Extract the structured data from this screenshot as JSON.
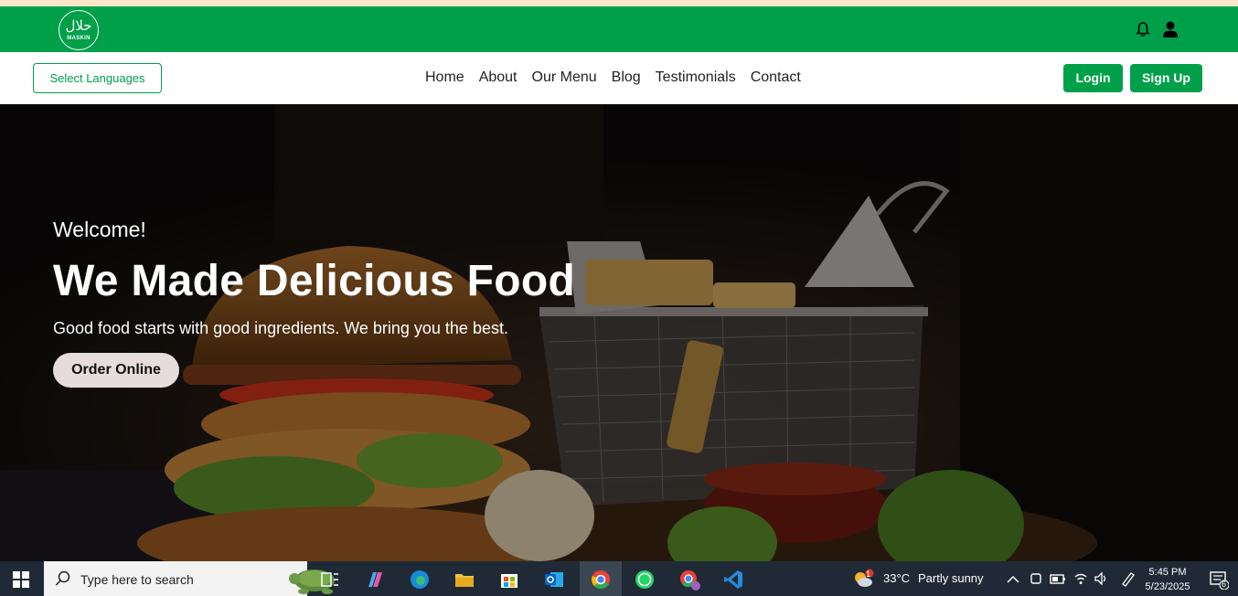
{
  "logo": {
    "arabic": "حلال",
    "text": "MASKIN"
  },
  "header": {
    "bell_icon": "bell-icon",
    "user_icon": "user-icon"
  },
  "navbar": {
    "language_button": "Select Languages",
    "links": [
      "Home",
      "About",
      "Our Menu",
      "Blog",
      "Testimonials",
      "Contact"
    ],
    "login": "Login",
    "signup": "Sign Up"
  },
  "hero": {
    "welcome": "Welcome!",
    "headline": "We Made Delicious Food",
    "subtitle": "Good food starts with good ingredients. We bring you the best.",
    "cta": "Order Online"
  },
  "taskbar": {
    "search_placeholder": "Type here to search",
    "weather_temp": "33°C",
    "weather_text": "Partly sunny",
    "weather_badge": "1",
    "time": "5:45 PM",
    "date": "5/23/2025",
    "notification_count": "6"
  },
  "colors": {
    "brand_green": "#00a04a",
    "top_strip": "#fbe6c8",
    "taskbar": "#1f2a36"
  }
}
